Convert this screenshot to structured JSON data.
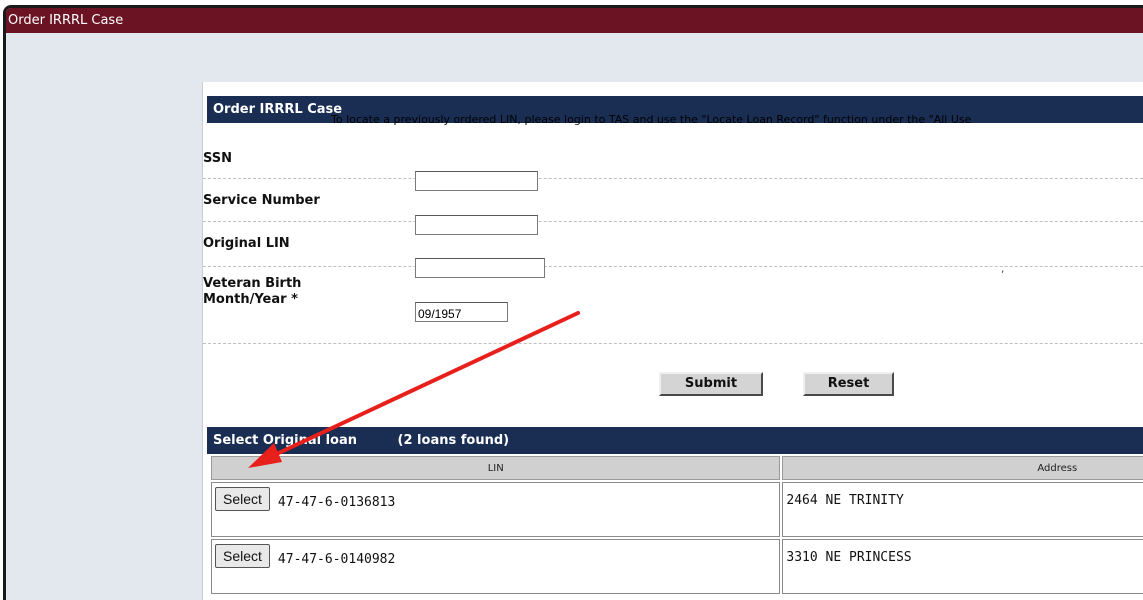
{
  "window": {
    "title": "Order IRRRL Case"
  },
  "form": {
    "header": "Order IRRRL Case",
    "notice": "To locate a previously ordered LIN, please login to TAS and use the \"Locate Loan Record\" function under the \"All Use",
    "fields": {
      "ssn": {
        "label": "SSN",
        "value": ""
      },
      "service_number": {
        "label": "Service Number",
        "value": ""
      },
      "original_lin": {
        "label": "Original LIN",
        "value": ""
      },
      "birth": {
        "label_line1": "Veteran Birth",
        "label_line2": "Month/Year *",
        "value": "09/1957"
      }
    },
    "buttons": {
      "submit": "Submit",
      "reset": "Reset"
    }
  },
  "loans": {
    "header": "Select Original loan",
    "count_text": "(2 loans found)",
    "columns": [
      "LIN",
      "Address"
    ],
    "select_label": "Select",
    "rows": [
      {
        "lin": "47-47-6-0136813",
        "address": "2464 NE TRINITY"
      },
      {
        "lin": "47-47-6-0140982",
        "address": "3310 NE PRINCESS"
      }
    ]
  },
  "colors": {
    "titlebar": "#6b1322",
    "section_header": "#1a2e54",
    "annotation_arrow": "#e8201c"
  },
  "annotation": {
    "icon": "red-arrow-icon"
  }
}
